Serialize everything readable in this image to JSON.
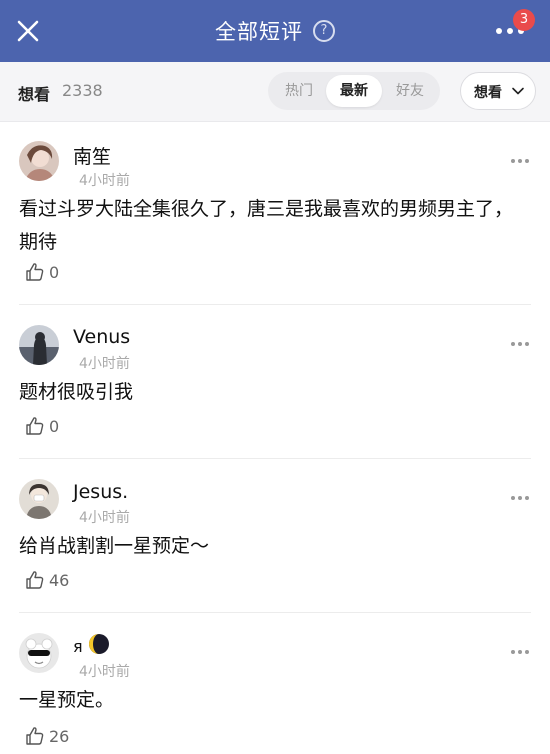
{
  "header": {
    "title": "全部短评",
    "help_icon": "question-circle-icon",
    "close_icon": "close-icon",
    "more_icon": "more-horizontal-icon",
    "notification_count": "3",
    "colors": {
      "bar": "#4c64ae",
      "badge": "#e94b4b"
    }
  },
  "subbar": {
    "label": "想看",
    "count": "2338",
    "tabs": [
      {
        "label": "热门",
        "active": false
      },
      {
        "label": "最新",
        "active": true
      },
      {
        "label": "好友",
        "active": false
      }
    ],
    "filter_label": "想看",
    "filter_icon": "chevron-down-icon"
  },
  "comments": [
    {
      "username": "南笙",
      "time": "4小时前",
      "text": "看过斗罗大陆全集很久了，唐三是我最喜欢的男频男主了，期待",
      "likes": "0"
    },
    {
      "username": "Venus",
      "time": "4小时前",
      "text": "题材很吸引我",
      "likes": "0"
    },
    {
      "username": "Jesus.",
      "time": "4小时前",
      "text": "给肖战割割一星预定～",
      "likes": "46"
    },
    {
      "username": "я",
      "time": "4小时前",
      "text": "一星预定。",
      "likes": "26"
    }
  ]
}
